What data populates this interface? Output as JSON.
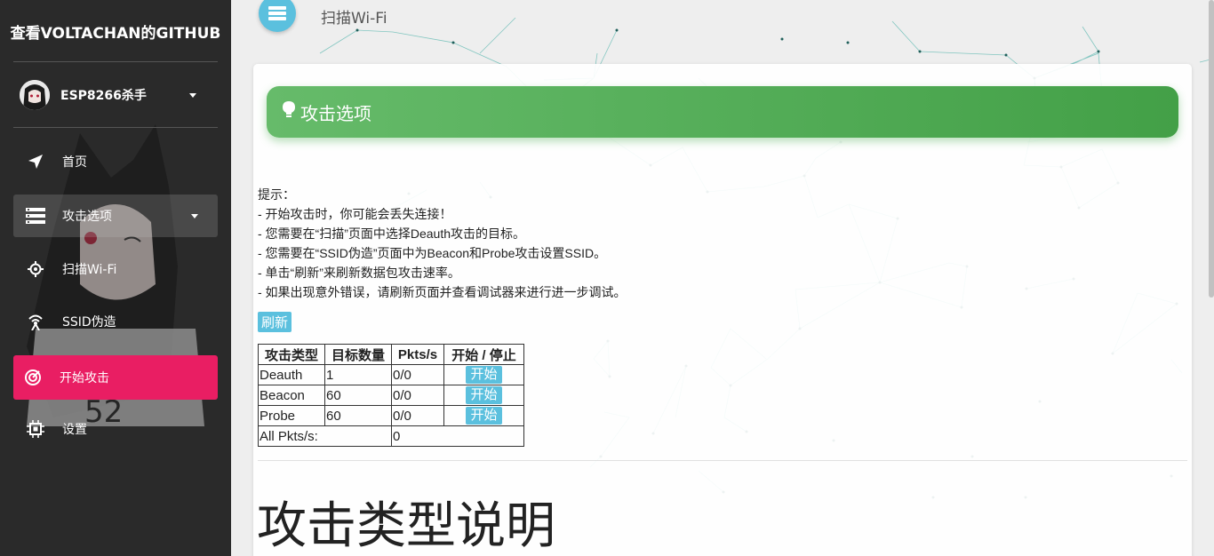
{
  "sidebar": {
    "brand": "查看VOLTACHAN的GITHUB",
    "user": {
      "name": "ESP8266杀手",
      "icon": "avatar"
    },
    "items": [
      {
        "label": "首页",
        "icon": "navigation-arrow-icon"
      },
      {
        "label": "攻击选项",
        "icon": "list-icon",
        "expanded": true
      },
      {
        "label": "扫描Wi-Fi",
        "icon": "target-icon"
      },
      {
        "label": "SSID伪造",
        "icon": "antenna-icon"
      },
      {
        "label": "开始攻击",
        "icon": "radar-icon",
        "active": true
      },
      {
        "label": "设置",
        "icon": "chip-icon"
      }
    ]
  },
  "header": {
    "title": "扫描Wi-Fi",
    "button_icon": "list-icon"
  },
  "card": {
    "title": "攻击选项",
    "title_icon": "lightbulb-icon",
    "hints": [
      "提示：",
      "- 开始攻击时，你可能会丢失连接！",
      "- 您需要在“扫描”页面中选择Deauth攻击的目标。",
      "- 您需要在“SSID伪造”页面中为Beacon和Probe攻击设置SSID。",
      "- 单击“刷新”来刷新数据包攻击速率。",
      "- 如果出现意外错误，请刷新页面并查看调试器来进行进一步调试。"
    ],
    "refresh_label": "刷新",
    "table": {
      "headers": [
        "攻击类型",
        "目标数量",
        "Pkts/s",
        "开始 / 停止"
      ],
      "rows": [
        {
          "type": "Deauth",
          "targets": "1",
          "pkts": "0/0",
          "action": "开始"
        },
        {
          "type": "Beacon",
          "targets": "60",
          "pkts": "0/0",
          "action": "开始"
        },
        {
          "type": "Probe",
          "targets": "60",
          "pkts": "0/0",
          "action": "开始"
        }
      ],
      "total_label": "All Pkts/s:",
      "total_value": "0"
    },
    "section_title": "攻击类型说明"
  },
  "colors": {
    "sidebar_bg": "#2a2a2a",
    "active_item": "#e91e63",
    "header_gradient_start": "#66bb6a",
    "header_gradient_end": "#43a047",
    "info_button": "#5bc0de"
  }
}
